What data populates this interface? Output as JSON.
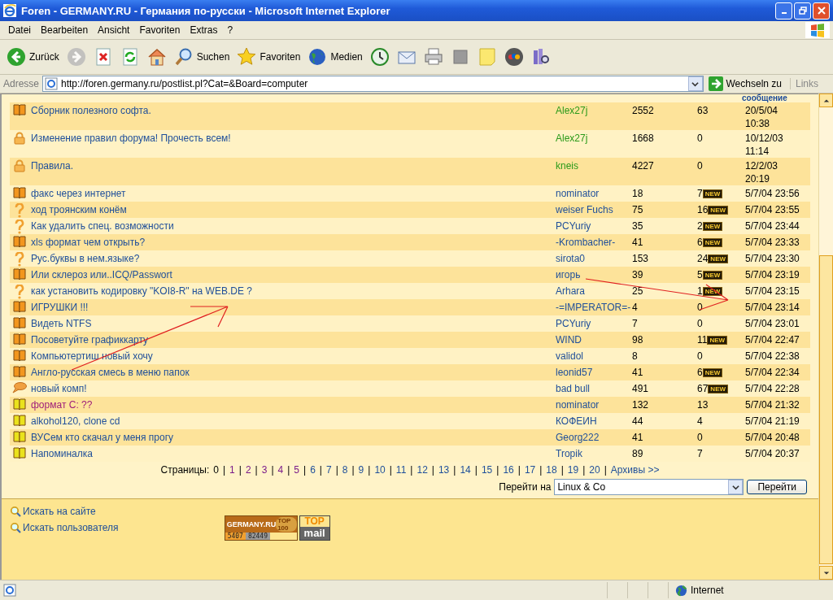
{
  "window": {
    "title": "Foren - GERMANY.RU - Германия по-русски - Microsoft Internet Explorer"
  },
  "menu": [
    "Datei",
    "Bearbeiten",
    "Ansicht",
    "Favoriten",
    "Extras",
    "?"
  ],
  "toolbar": [
    {
      "kind": "back",
      "label": "Zurück"
    },
    {
      "kind": "forward"
    },
    {
      "kind": "stop"
    },
    {
      "kind": "refresh"
    },
    {
      "kind": "home"
    },
    {
      "kind": "search",
      "label": "Suchen"
    },
    {
      "kind": "favorites",
      "label": "Favoriten"
    },
    {
      "kind": "media",
      "label": "Medien"
    },
    {
      "kind": "history"
    },
    {
      "kind": "mail"
    },
    {
      "kind": "print"
    },
    {
      "kind": "edit"
    },
    {
      "kind": "note"
    },
    {
      "kind": "ebay"
    },
    {
      "kind": "research"
    }
  ],
  "address": {
    "label": "Adresse",
    "url": "http://foren.germany.ru/postlist.pl?Cat=&Board=computer",
    "go": "Wechseln zu",
    "links": "Links"
  },
  "table": {
    "header_last": "сообщение",
    "rows": [
      {
        "kind": "book",
        "title": "Сборник полезного софта.",
        "visited": false,
        "author": "Alex27j",
        "moderator": true,
        "views": "2552",
        "replies": "63",
        "date": "20/5/04 10:38",
        "pinned": true
      },
      {
        "kind": "lock",
        "title": "Изменение правил форума! Прочесть всем!",
        "visited": false,
        "author": "Alex27j",
        "moderator": true,
        "views": "1668",
        "replies": "0",
        "date": "10/12/03 11:14",
        "pinned": true
      },
      {
        "kind": "lock",
        "title": "Правила.",
        "visited": false,
        "author": "kneis",
        "moderator": true,
        "views": "4227",
        "replies": "0",
        "date": "12/2/03 20:19",
        "pinned": true
      },
      {
        "kind": "book",
        "title": "факс через интернет",
        "visited": false,
        "author": "nominator",
        "moderator": false,
        "views": "18",
        "replies": "7",
        "badge": "NEW",
        "date": "5/7/04 23:56",
        "pinned": false
      },
      {
        "kind": "question",
        "title": "ход троянским конём",
        "visited": false,
        "author": "weiser Fuchs",
        "moderator": false,
        "views": "75",
        "replies": "16",
        "badge": "NEW",
        "date": "5/7/04 23:55",
        "pinned": false
      },
      {
        "kind": "question",
        "title": "Как удалить спец. возможности",
        "visited": false,
        "author": "PCYuriy",
        "moderator": false,
        "views": "35",
        "replies": "2",
        "badge": "NEW",
        "date": "5/7/04 23:44",
        "pinned": false
      },
      {
        "kind": "book",
        "title": "xls формат чем открыть?",
        "visited": false,
        "author": "-Krombacher-",
        "moderator": false,
        "views": "41",
        "replies": "6",
        "badge": "NEW",
        "date": "5/7/04 23:33",
        "pinned": false
      },
      {
        "kind": "question",
        "title": "Рус.буквы в нем.языке?",
        "visited": false,
        "author": "sirota0",
        "moderator": false,
        "views": "153",
        "replies": "24",
        "badge": "NEW",
        "date": "5/7/04 23:30",
        "pinned": false
      },
      {
        "kind": "book",
        "title": "Или склероз или..ICQ/Passwort",
        "visited": false,
        "author": "игорь",
        "moderator": false,
        "views": "39",
        "replies": "5",
        "badge": "NEW",
        "date": "5/7/04 23:19",
        "pinned": false
      },
      {
        "kind": "question",
        "title": "как установить кодировку \"KOI8-R\" на WEB.DE ?",
        "visited": false,
        "author": "Arhara",
        "moderator": false,
        "views": "25",
        "replies": "1",
        "badge": "NEW",
        "date": "5/7/04 23:15",
        "pinned": false
      },
      {
        "kind": "book",
        "title": "ИГРУШКИ !!!",
        "visited": false,
        "author": "-=IMPERATOR=-",
        "moderator": false,
        "views": "4",
        "replies": "0",
        "date": "5/7/04 23:14",
        "pinned": false
      },
      {
        "kind": "book",
        "title": "Видеть NTFS",
        "visited": false,
        "author": "PCYuriy",
        "moderator": false,
        "views": "7",
        "replies": "0",
        "date": "5/7/04 23:01",
        "pinned": false
      },
      {
        "kind": "book",
        "title": "Посоветуйте графиккарту",
        "visited": false,
        "author": "WIND",
        "moderator": false,
        "views": "98",
        "replies": "11",
        "badge": "NEW",
        "date": "5/7/04 22:47",
        "pinned": false
      },
      {
        "kind": "book",
        "title": "Компьютертиш новый хочу",
        "visited": false,
        "author": "validol",
        "moderator": false,
        "views": "8",
        "replies": "0",
        "date": "5/7/04 22:38",
        "pinned": false
      },
      {
        "kind": "book",
        "title": "Англо-русская смесь в меню папок",
        "visited": false,
        "author": "leonid57",
        "moderator": false,
        "views": "41",
        "replies": "6",
        "badge": "NEW",
        "date": "5/7/04 22:34",
        "pinned": false
      },
      {
        "kind": "bubble",
        "title": "новый комп!",
        "visited": false,
        "author": "bad bull",
        "moderator": false,
        "views": "491",
        "replies": "67",
        "badge": "NEW",
        "date": "5/7/04 22:28",
        "pinned": false
      },
      {
        "kind": "book_yellow",
        "title": "формат С: ??",
        "visited": true,
        "author": "nominator",
        "moderator": false,
        "views": "132",
        "replies": "13",
        "date": "5/7/04 21:32",
        "pinned": false
      },
      {
        "kind": "book_yellow",
        "title": "alkohol120, clone cd",
        "visited": false,
        "author": "КОФЕИН",
        "moderator": false,
        "views": "44",
        "replies": "4",
        "date": "5/7/04 21:19",
        "pinned": false
      },
      {
        "kind": "book_yellow",
        "title": "ВУСем кто скачал у меня прогу",
        "visited": false,
        "author": "Georg222",
        "moderator": false,
        "views": "41",
        "replies": "0",
        "date": "5/7/04 20:48",
        "pinned": false
      },
      {
        "kind": "book_yellow",
        "title": "Напоминалка",
        "visited": false,
        "author": "Tropik",
        "moderator": false,
        "views": "89",
        "replies": "7",
        "date": "5/7/04 20:37",
        "pinned": false
      }
    ]
  },
  "pages": {
    "label": "Страницы:",
    "separator": "|",
    "items": [
      {
        "label": "0",
        "selected": true,
        "visited": false
      },
      {
        "label": "1",
        "selected": false,
        "visited": true
      },
      {
        "label": "2",
        "selected": false,
        "visited": true
      },
      {
        "label": "3",
        "selected": false,
        "visited": true
      },
      {
        "label": "4",
        "selected": false,
        "visited": true
      },
      {
        "label": "5",
        "selected": false,
        "visited": true
      },
      {
        "label": "6",
        "selected": false,
        "visited": false
      },
      {
        "label": "7",
        "selected": false,
        "visited": false
      },
      {
        "label": "8",
        "selected": false,
        "visited": false
      },
      {
        "label": "9",
        "selected": false,
        "visited": false
      },
      {
        "label": "10",
        "selected": false,
        "visited": false
      },
      {
        "label": "11",
        "selected": false,
        "visited": false
      },
      {
        "label": "12",
        "selected": false,
        "visited": false
      },
      {
        "label": "13",
        "selected": false,
        "visited": false
      },
      {
        "label": "14",
        "selected": false,
        "visited": false
      },
      {
        "label": "15",
        "selected": false,
        "visited": false
      },
      {
        "label": "16",
        "selected": false,
        "visited": false
      },
      {
        "label": "17",
        "selected": false,
        "visited": false
      },
      {
        "label": "18",
        "selected": false,
        "visited": false
      },
      {
        "label": "19",
        "selected": false,
        "visited": false
      },
      {
        "label": "20",
        "selected": false,
        "visited": false
      },
      {
        "label": "Архивы >>",
        "selected": false,
        "visited": false
      }
    ]
  },
  "jump": {
    "label": "Перейти на",
    "value": "Linux & Co",
    "button": "Перейти"
  },
  "footer_links": [
    "Искать на сайте",
    "Искать пользователя"
  ],
  "counter": {
    "name": "GERMANY.RU",
    "rank": "TOP 100",
    "hits": "5407",
    "hosts": "82449"
  },
  "mail_badge": {
    "top": "TOP",
    "bottom": "mail"
  },
  "status_bar": {
    "zone": "Internet"
  }
}
